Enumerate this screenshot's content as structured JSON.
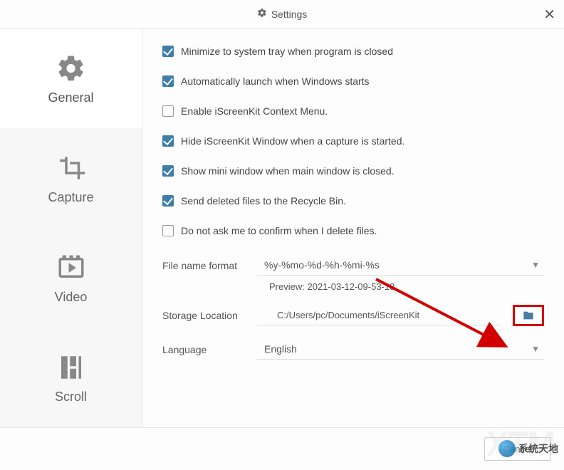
{
  "title": "Settings",
  "sidebar": {
    "items": [
      {
        "label": "General"
      },
      {
        "label": "Capture"
      },
      {
        "label": "Video"
      },
      {
        "label": "Scroll"
      }
    ]
  },
  "options": {
    "minimize": {
      "label": "Minimize to system tray when program is closed",
      "checked": true
    },
    "autolaunch": {
      "label": "Automatically launch when Windows starts",
      "checked": true
    },
    "contextmenu": {
      "label": "Enable iScreenKit Context Menu.",
      "checked": false
    },
    "hidewindow": {
      "label": "Hide iScreenKit Window when a capture is started.",
      "checked": true
    },
    "miniwindow": {
      "label": "Show mini window when main window is closed.",
      "checked": true
    },
    "recyclebin": {
      "label": "Send deleted files to the Recycle Bin.",
      "checked": true
    },
    "noconfirm": {
      "label": "Do not ask me to confirm when I delete files.",
      "checked": false
    }
  },
  "filename": {
    "label": "File name format",
    "value": "%y-%mo-%d-%h-%mi-%s",
    "preview_label": "Preview:",
    "preview_value": "2021-03-12-09-53-18"
  },
  "storage": {
    "label": "Storage Location",
    "value": "C:/Users/pc/Documents/iScreenKit"
  },
  "language": {
    "label": "Language",
    "value": "English"
  },
  "footer": {
    "cancel": "Cancel"
  },
  "watermark": {
    "text": "系统天地"
  }
}
